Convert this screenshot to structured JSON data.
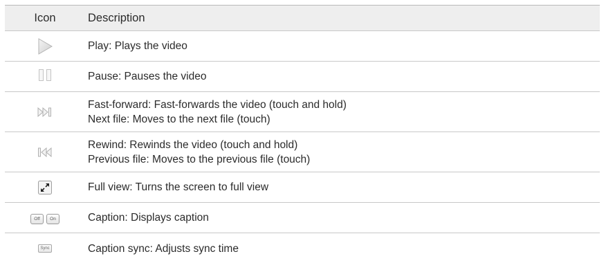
{
  "table": {
    "header": {
      "icon": "Icon",
      "description": "Description"
    },
    "rows": [
      {
        "icon": "play-icon",
        "lines": [
          "Play: Plays the video"
        ]
      },
      {
        "icon": "pause-icon",
        "lines": [
          "Pause: Pauses the video"
        ]
      },
      {
        "icon": "fast-forward-icon",
        "lines": [
          "Fast-forward: Fast-forwards the video (touch and hold)",
          "Next file: Moves to the next file (touch)"
        ]
      },
      {
        "icon": "rewind-icon",
        "lines": [
          "Rewind: Rewinds the video (touch and hold)",
          "Previous file: Moves to the previous file (touch)"
        ]
      },
      {
        "icon": "full-view-icon",
        "lines": [
          "Full view: Turns the screen to full view"
        ]
      },
      {
        "icon": "caption-icon",
        "icon_labels": [
          "Off",
          "On"
        ],
        "lines": [
          "Caption: Displays caption"
        ]
      },
      {
        "icon": "caption-sync-icon",
        "icon_labels": [
          "Sync"
        ],
        "lines": [
          "Caption sync: Adjusts sync time"
        ]
      }
    ]
  }
}
